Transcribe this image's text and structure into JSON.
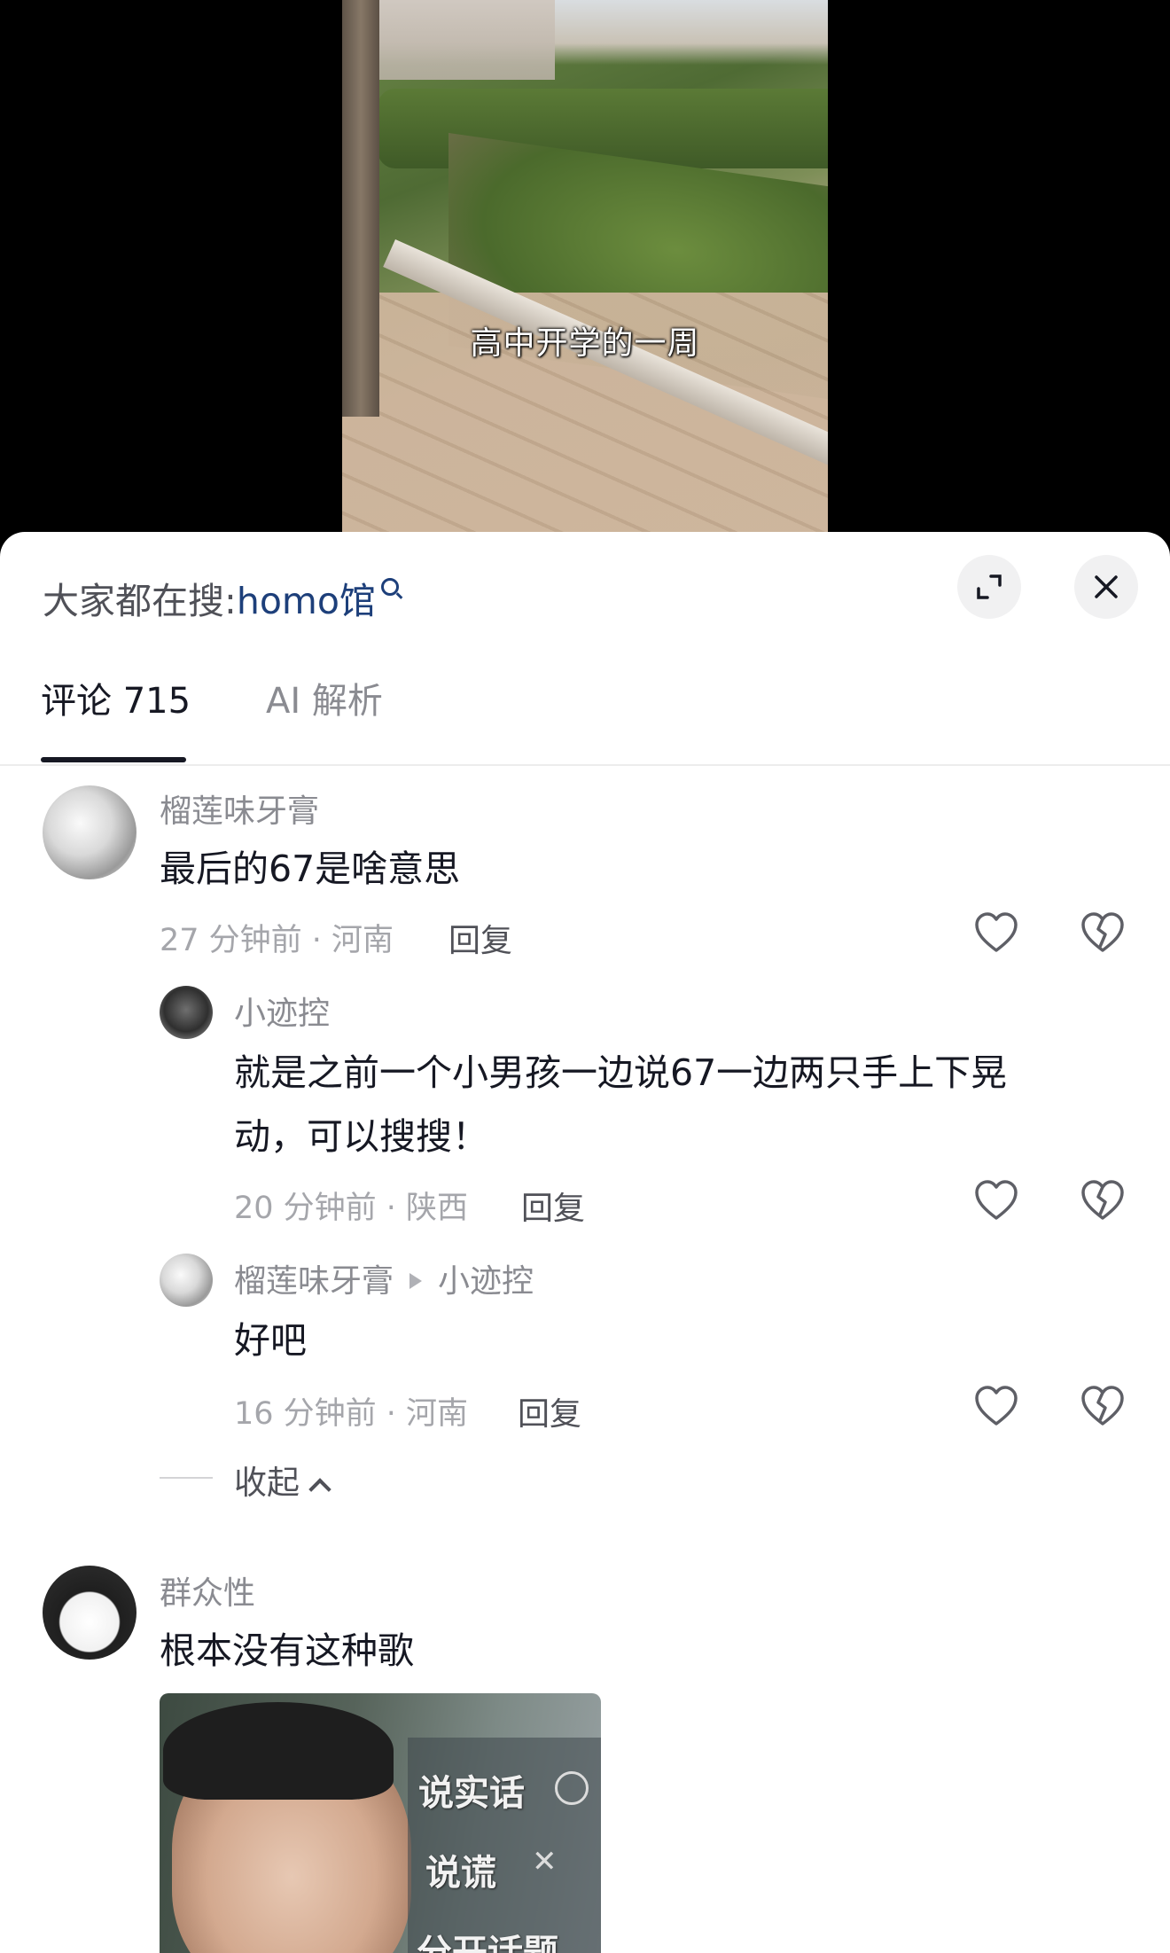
{
  "video": {
    "caption": "高中开学的一周"
  },
  "search_bar": {
    "prefix": "大家都在搜:",
    "keyword": "homo馆",
    "search_icon": "search-icon"
  },
  "header_buttons": {
    "expand_icon": "expand-icon",
    "close_icon": "close-icon"
  },
  "tabs": [
    {
      "label": "评论 715",
      "active": true
    },
    {
      "label": "AI 解析",
      "active": false
    }
  ],
  "comments": [
    {
      "author": "榴莲味牙膏",
      "text": "最后的67是啥意思",
      "meta": "27 分钟前 · 河南",
      "reply_label": "回复",
      "replies": [
        {
          "author": "小迹控",
          "text": "就是之前一个小男孩一边说67一边两只手上下晃动，可以搜搜！",
          "text_line1": "就是之前一个小男孩一边说67一边两只手上下晃",
          "text_line2": "动，可以搜搜！",
          "meta": "20 分钟前 · 陕西",
          "reply_label": "回复"
        },
        {
          "author": "榴莲味牙膏",
          "reply_to": "小迹控",
          "text": "好吧",
          "meta": "16 分钟前 · 河南",
          "reply_label": "回复"
        }
      ],
      "collapse_label": "收起"
    },
    {
      "author": "群众性",
      "text": "根本没有这种歌",
      "image": {
        "label_truth": "说实话",
        "label_lie": "说谎",
        "label_topic": "分开话题"
      }
    }
  ],
  "colors": {
    "accent_keyword": "#1d3f7a",
    "text_primary": "#161823",
    "text_secondary": "#8a8b91"
  }
}
